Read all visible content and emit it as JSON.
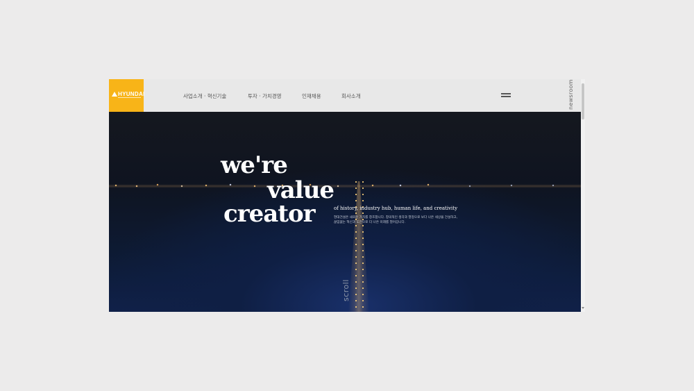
{
  "header": {
    "logo_text": "HYUNDAI",
    "nav": [
      {
        "label": "사업소개 · 혁신기술"
      },
      {
        "label": "투자 · 가치경영"
      },
      {
        "label": "인재채용"
      },
      {
        "label": "회사소개"
      }
    ],
    "newsroom_label": "newsroom"
  },
  "hero": {
    "headline_line1": "we're",
    "headline_line2": "value",
    "headline_line3": "creator",
    "tagline": "of history, industry hub, human life, and creativity",
    "description_line1": "현대건설은 새로운 가치를 창조합니다. 창의적인 생각과 열정으로 보다 나은 세상을 건설하고,",
    "description_line2": "끊임없는 혁신과 도전으로 더 나은 미래를 열어갑니다.",
    "scroll_label": "scroll"
  },
  "colors": {
    "brand_yellow": "#f8b418",
    "header_bg": "#e8e8e8",
    "hero_navy": "#10214a"
  },
  "icons": {
    "menu": "hamburger-menu-icon",
    "logo": "hyundai-triangle-logo"
  }
}
